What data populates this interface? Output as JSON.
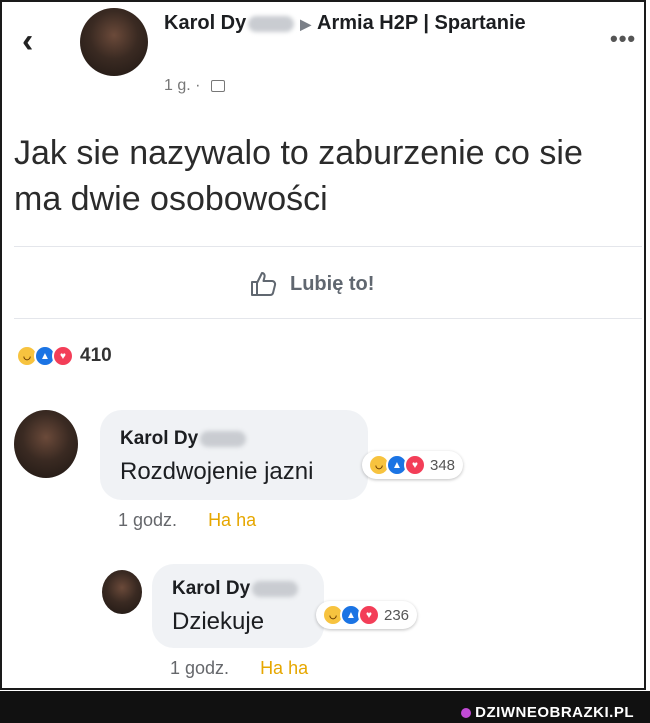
{
  "header": {
    "author": "Karol Dy",
    "group": "Armia H2P | Spartanie",
    "time": "1 g.",
    "separator": "·"
  },
  "icons": {
    "back": "chevron-left-icon",
    "more": "more-dots-icon",
    "like": "thumb-up-icon",
    "privacy": "group-privacy-icon"
  },
  "post": {
    "text": "Jak sie nazywalo to zaburzenie co sie ma dwie osobowości",
    "like_label": "Lubię to!",
    "reaction_count": "410"
  },
  "comments": [
    {
      "author": "Karol Dy",
      "text": "Rozdwojenie jazni",
      "reaction_count": "348",
      "time": "1 godz.",
      "reaction_label": "Ha ha"
    },
    {
      "author": "Karol Dy",
      "text": "Dziekuje",
      "reaction_count": "236",
      "time": "1 godz.",
      "reaction_label": "Ha ha"
    }
  ],
  "colors": {
    "haha": "#f7c33f",
    "like": "#1b74e4",
    "love": "#f33e58",
    "haha_link": "#e6a700"
  },
  "watermark": {
    "text": "DZIWNEOBRAZKI.PL"
  }
}
